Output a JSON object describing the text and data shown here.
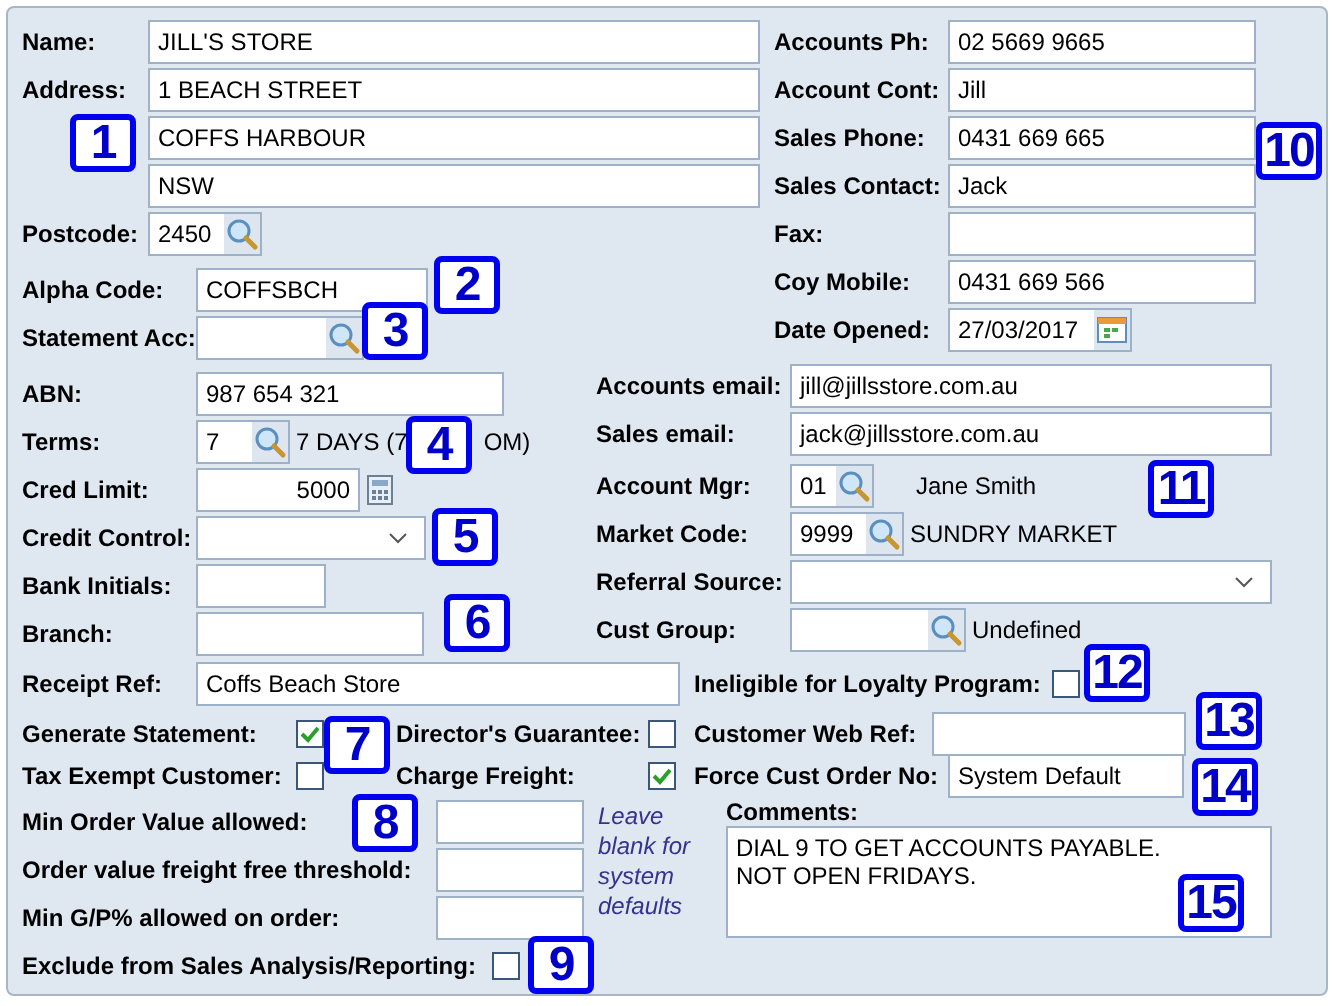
{
  "contact": {
    "name": {
      "label": "Name:",
      "value": "JILL'S STORE"
    },
    "address": {
      "label": "Address:",
      "lines": [
        "1 BEACH STREET",
        "COFFS HARBOUR",
        "NSW"
      ]
    },
    "postcode": {
      "label": "Postcode:",
      "value": "2450"
    },
    "alpha_code": {
      "label": "Alpha Code:",
      "value": "COFFSBCH"
    },
    "statement_acc": {
      "label": "Statement Acc:"
    }
  },
  "phones": [
    {
      "kind": "text",
      "label": "Accounts Ph:",
      "value": "02 5669 9665"
    },
    {
      "kind": "text",
      "label": "Account Cont:",
      "value": "Jill"
    },
    {
      "kind": "text",
      "label": "Sales Phone:",
      "value": "0431 669 665"
    },
    {
      "kind": "text",
      "label": "Sales Contact:",
      "value": "Jack"
    },
    {
      "kind": "text",
      "label": "Fax:"
    },
    {
      "kind": "text",
      "label": "Coy Mobile:",
      "value": "0431 669 566"
    },
    {
      "kind": "date",
      "label": "Date Opened:",
      "value": "27/03/2017"
    }
  ],
  "account": [
    {
      "kind": "text",
      "label": "ABN:",
      "value": "987 654 321"
    },
    {
      "kind": "lookup",
      "label": "Terms:",
      "value": "7",
      "description": "7 DAYS (7",
      "description_tail": "OM)"
    },
    {
      "kind": "calc",
      "label": "Cred Limit:",
      "value": "5000"
    },
    {
      "kind": "dropdown",
      "label": "Credit Control:"
    },
    {
      "kind": "text",
      "label": "Bank Initials:"
    },
    {
      "kind": "text",
      "label": "Branch:"
    }
  ],
  "receipt_ref": {
    "label": "Receipt Ref:",
    "value": "Coffs Beach Store"
  },
  "emails": [
    {
      "label": "Accounts email:",
      "value": "jill@jillsstore.com.au"
    },
    {
      "label": "Sales email:",
      "value": "jack@jillsstore.com.au"
    }
  ],
  "lookups": [
    {
      "kind": "lookup",
      "label": "Account Mgr:",
      "value": "01",
      "description": "Jane Smith"
    },
    {
      "kind": "lookup",
      "label": "Market Code:",
      "value": "9999",
      "description": "SUNDRY MARKET"
    },
    {
      "kind": "dropdown",
      "label": "Referral Source:"
    },
    {
      "kind": "lookup",
      "label": "Cust Group:",
      "description": "Undefined"
    }
  ],
  "loyalty": {
    "label": "Ineligible for Loyalty Program:",
    "checked": false
  },
  "flags": [
    {
      "label": "Generate Statement:",
      "checked": true
    },
    {
      "label": "Tax Exempt Customer:",
      "checked": false
    }
  ],
  "flags2": [
    {
      "label": "Director's Guarantee:",
      "checked": false
    },
    {
      "label": "Charge Freight:",
      "checked": true
    }
  ],
  "web_ref": {
    "label": "Customer Web Ref:"
  },
  "force_order": {
    "label": "Force Cust Order No:",
    "value": "System Default"
  },
  "limits": [
    {
      "label": "Min Order Value allowed:"
    },
    {
      "label": "Order value freight free threshold:"
    },
    {
      "label": "Min G/P% allowed on order:"
    }
  ],
  "limits_hint": "Leave blank for system defaults",
  "exclude": {
    "label": "Exclude from Sales Analysis/Reporting:",
    "checked": false
  },
  "comments": {
    "label": "Comments:",
    "value": "DIAL 9 TO GET ACCOUNTS PAYABLE.\nNOT OPEN FRIDAYS."
  },
  "badges": [
    "1",
    "2",
    "3",
    "4",
    "5",
    "6",
    "7",
    "8",
    "9",
    "10",
    "11",
    "12",
    "13",
    "14",
    "15"
  ]
}
